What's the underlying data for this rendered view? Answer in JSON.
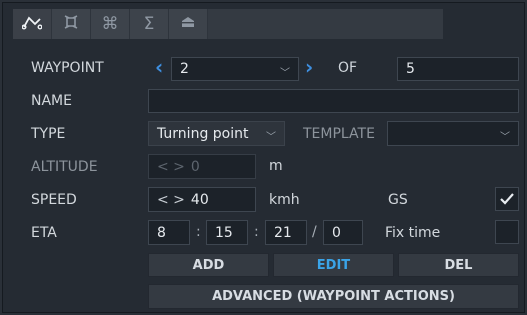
{
  "tabs": [
    {
      "icon": "route-icon",
      "active": true
    },
    {
      "icon": "target-icon",
      "active": false
    },
    {
      "icon": "command-icon",
      "active": false
    },
    {
      "icon": "sigma-icon",
      "active": false
    },
    {
      "icon": "home-icon",
      "active": false
    }
  ],
  "waypoint": {
    "label": "WAYPOINT",
    "value": "2",
    "of_label": "OF",
    "total": "5"
  },
  "name": {
    "label": "NAME",
    "value": ""
  },
  "type": {
    "label": "TYPE",
    "value": "Turning point",
    "template_label": "TEMPLATE",
    "template_value": ""
  },
  "altitude": {
    "label": "ALTITUDE",
    "arrows": "< >",
    "value": "0",
    "unit": "m"
  },
  "speed": {
    "label": "SPEED",
    "arrows": "< >",
    "value": "40",
    "unit": "kmh",
    "gs_label": "GS",
    "gs_checked": true
  },
  "eta": {
    "label": "ETA",
    "hours": "8",
    "minutes": "15",
    "seconds": "21",
    "day": "0",
    "sep1": ":",
    "sep2": ":",
    "sep3": "/",
    "fix_label": "Fix time",
    "fix_checked": false
  },
  "buttons": {
    "add": "ADD",
    "edit": "EDIT",
    "del": "DEL",
    "advanced": "ADVANCED (WAYPOINT ACTIONS)"
  },
  "colors": {
    "accent": "#3e8fe0",
    "active_button_text": "#3aa4e8",
    "background": "#252b33"
  }
}
